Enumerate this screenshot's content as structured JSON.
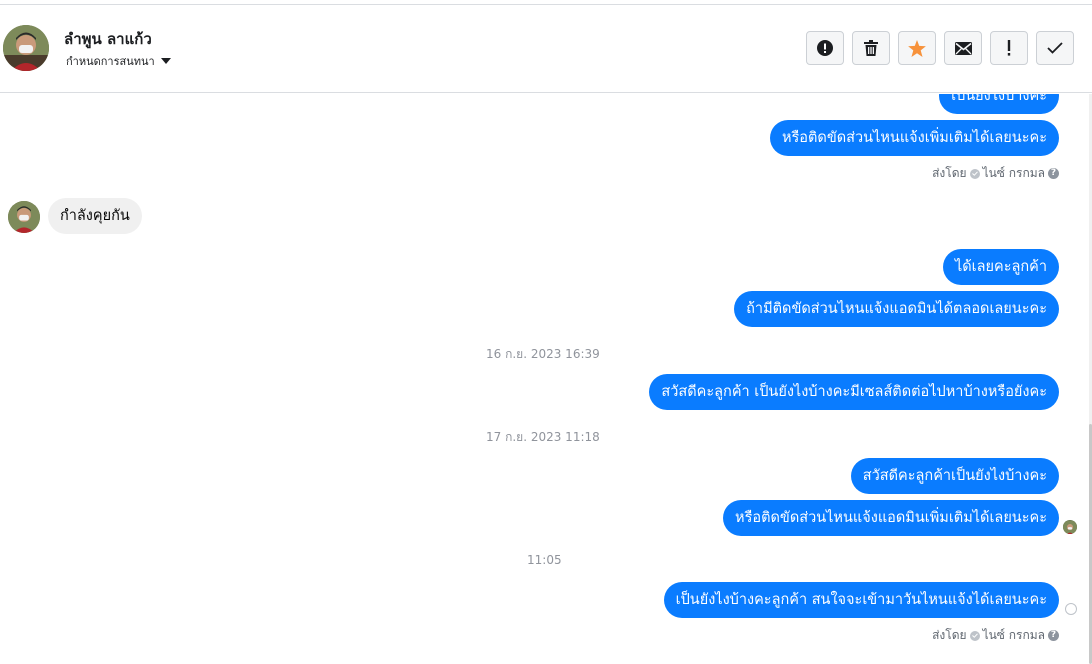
{
  "header": {
    "contact_name": "ลำพูน ลาแก้ว",
    "conversation_options": "กำหนดการสนทนา",
    "toolbar": [
      {
        "name": "spam-button",
        "icon": "alert-circle-icon"
      },
      {
        "name": "delete-button",
        "icon": "trash-icon"
      },
      {
        "name": "star-button",
        "icon": "star-icon",
        "color": "#f7923b"
      },
      {
        "name": "mark-unread-button",
        "icon": "envelope-icon"
      },
      {
        "name": "important-button",
        "icon": "exclamation-icon"
      },
      {
        "name": "done-button",
        "icon": "check-icon"
      }
    ]
  },
  "messages": {
    "out_1_partial": "เป็นยังไงบ้างคะ",
    "out_2": "หรือติดขัดส่วนไหนแจ้งเพิ่มเติมได้เลยนะคะ",
    "sent_by_1": {
      "prefix": "ส่งโดย",
      "name": "ไนซ์ กรกมล"
    },
    "in_1": "กำลังคุยกัน",
    "out_3": "ได้เลยคะลูกค้า",
    "out_4": "ถ้ามีติดขัดส่วนไหนแจ้งแอดมินได้ตลอดเลยนะคะ",
    "timestamp_1": "16 ก.ย. 2023 16:39",
    "out_5": "สวัสดีคะลูกค้า เป็นยังไงบ้างคะมีเซลส์ติดต่อไปหาบ้างหรือยังคะ",
    "timestamp_2": "17 ก.ย. 2023 11:18",
    "out_6": "สวัสดีคะลูกค้าเป็นยังไงบ้างคะ",
    "out_7": "หรือติดขัดส่วนไหนแจ้งแอดมินเพิ่มเติมได้เลยนะคะ",
    "timestamp_3": "11:05",
    "out_8": "เป็นยังไงบ้างคะลูกค้า สนใจจะเข้ามาวันไหนแจ้งได้เลยนะคะ",
    "sent_by_2": {
      "prefix": "ส่งโดย",
      "name": "ไนซ์ กรกมล"
    }
  },
  "colors": {
    "bubble_out": "#0a7cff",
    "bubble_in": "#f0f0f0",
    "star": "#f7923b"
  }
}
